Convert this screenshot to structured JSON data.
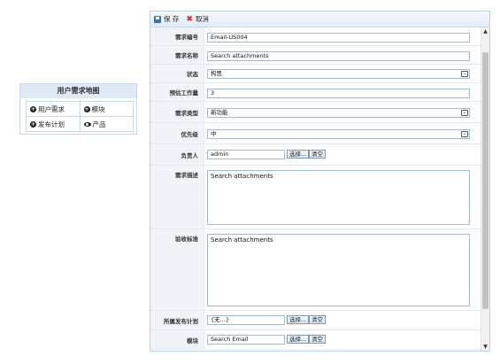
{
  "story_map": {
    "title": "用户需求地图",
    "items": [
      {
        "label": "用户需求",
        "icon": "plus-circle-icon"
      },
      {
        "label": "模块",
        "icon": "plus-circle-icon"
      },
      {
        "label": "发布计划",
        "icon": "plus-circle-icon"
      },
      {
        "label": "产品",
        "icon": "eye-icon"
      }
    ]
  },
  "toolbar": {
    "save_label": "保 存",
    "cancel_label": "取消"
  },
  "form": {
    "req_no_label": "需求编号",
    "req_no_value": "Email-US004",
    "req_name_label": "需求名称",
    "req_name_value": "Search attachments",
    "status_label": "状态",
    "status_value": "构思",
    "estimate_label": "预估工作量",
    "estimate_value": "3",
    "type_label": "需求类型",
    "type_value": "新功能",
    "priority_label": "优先级",
    "priority_value": "中",
    "owner_label": "负责人",
    "owner_value": "admin",
    "desc_label": "需求描述",
    "desc_value": "Search attachments",
    "accept_label": "验收标准",
    "accept_value": "Search attachments",
    "release_label": "所属发布计划",
    "release_value": "{无...}",
    "module_label": "模块",
    "module_value": "Search Email",
    "select_label": "选择...",
    "clear_label": "清空"
  }
}
